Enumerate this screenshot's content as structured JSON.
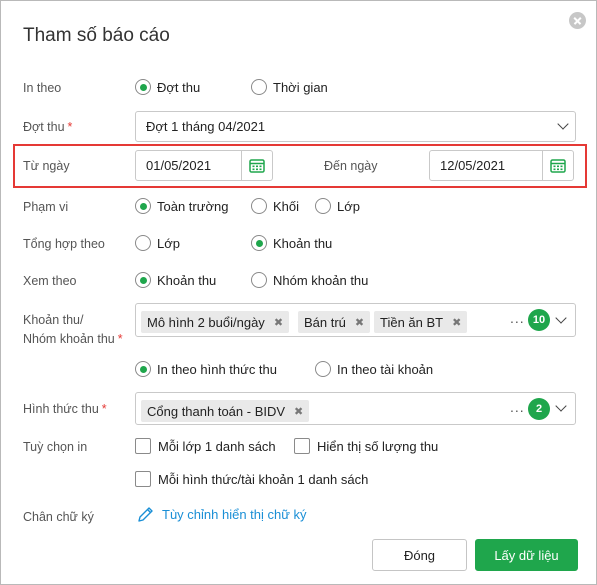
{
  "dialog": {
    "title": "Tham số báo cáo"
  },
  "in_theo": {
    "label": "In theo",
    "options": [
      "Đợt thu",
      "Thời gian"
    ],
    "selected": "Đợt thu"
  },
  "dot_thu": {
    "label": "Đợt thu",
    "required_mark": "*",
    "value": "Đợt 1 tháng 04/2021"
  },
  "tu_ngay": {
    "label": "Từ ngày",
    "value": "01/05/2021"
  },
  "den_ngay": {
    "label": "Đến ngày",
    "value": "12/05/2021"
  },
  "pham_vi": {
    "label": "Phạm vi",
    "options": [
      "Toàn trường",
      "Khối",
      "Lớp"
    ],
    "selected": "Toàn trường"
  },
  "tong_hop_theo": {
    "label": "Tổng hợp theo",
    "options": [
      "Lớp",
      "Khoản thu"
    ],
    "selected": "Khoản thu"
  },
  "xem_theo": {
    "label": "Xem theo",
    "options": [
      "Khoản thu",
      "Nhóm khoản thu"
    ],
    "selected": "Khoản thu"
  },
  "khoan_thu": {
    "label_line1": "Khoản thu/",
    "label_line2": "Nhóm khoản thu",
    "required_mark": "*",
    "tags": [
      "Mô hình 2 buổi/ngày",
      "Bán trú",
      "Tiền ăn BT"
    ],
    "more": "...",
    "count": "10",
    "print_options": [
      "In theo hình thức thu",
      "In theo tài khoản"
    ],
    "print_selected": "In theo hình thức thu"
  },
  "hinh_thuc_thu": {
    "label": "Hình thức thu",
    "required_mark": "*",
    "tags": [
      "Cổng thanh toán - BIDV"
    ],
    "more": "...",
    "count": "2"
  },
  "tuy_chon_in": {
    "label": "Tuỳ chọn in",
    "options": [
      "Mỗi lớp 1 danh sách",
      "Hiển thị số lượng thu",
      "Mỗi hình thức/tài khoản 1 danh sách"
    ]
  },
  "chan_chu_ky": {
    "label": "Chân chữ ký",
    "link": "Tùy chỉnh hiển thị chữ ký"
  },
  "buttons": {
    "close": "Đóng",
    "submit": "Lấy dữ liệu"
  },
  "colors": {
    "accent": "#1fa64c",
    "link": "#1a8fd6",
    "required": "#e53935",
    "highlight_border": "#e53935"
  },
  "icons": {
    "close": "close-icon",
    "calendar": "calendar-icon",
    "chevron": "chevron-down-icon",
    "pencil": "pencil-icon",
    "tag_remove": "remove-tag-icon"
  }
}
